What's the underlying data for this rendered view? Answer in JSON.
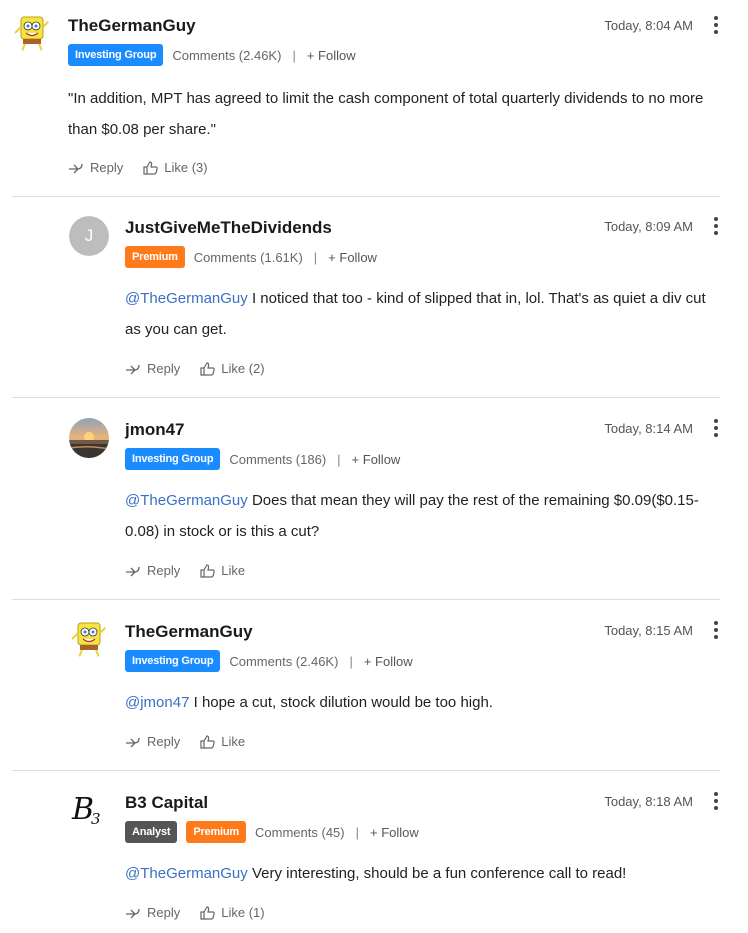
{
  "comments": [
    {
      "username": "TheGermanGuy",
      "avatar": "spongebob-avatar",
      "badges": [
        {
          "label": "Investing Group",
          "color": "#1a8cff"
        }
      ],
      "comments_label": "Comments (2.46K)",
      "follow": "+ Follow",
      "separator": "|",
      "time": "Today, 8:04 AM",
      "text": "\"In addition, MPT has agreed to limit the cash component of total quarterly dividends to no more than $0.08 per share.\"",
      "mention": "",
      "reply": "Reply",
      "like": "Like (3)"
    },
    {
      "username": "JustGiveMeTheDividends",
      "avatar_initial": "J",
      "badges": [
        {
          "label": "Premium",
          "color": "#ff7a1a"
        }
      ],
      "comments_label": "Comments (1.61K)",
      "follow": "+ Follow",
      "separator": "|",
      "time": "Today, 8:09 AM",
      "mention": "@TheGermanGuy",
      "text": " I noticed that too - kind of slipped that in, lol. That's as quiet a div cut as you can get.",
      "reply": "Reply",
      "like": "Like (2)"
    },
    {
      "username": "jmon47",
      "avatar": "sunset-avatar",
      "badges": [
        {
          "label": "Investing Group",
          "color": "#1a8cff"
        }
      ],
      "comments_label": "Comments (186)",
      "follow": "+ Follow",
      "separator": "|",
      "time": "Today, 8:14 AM",
      "mention": "@TheGermanGuy",
      "text": " Does that mean they will pay the rest of the remaining $0.09($0.15-0.08) in stock or is this a cut?",
      "reply": "Reply",
      "like": "Like"
    },
    {
      "username": "TheGermanGuy",
      "avatar": "spongebob-avatar",
      "badges": [
        {
          "label": "Investing Group",
          "color": "#1a8cff"
        }
      ],
      "comments_label": "Comments (2.46K)",
      "follow": "+ Follow",
      "separator": "|",
      "time": "Today, 8:15 AM",
      "mention": "@jmon47",
      "text": " I hope a cut, stock dilution would be too high.",
      "reply": "Reply",
      "like": "Like"
    },
    {
      "username": "B3 Capital",
      "avatar_logo": "B",
      "avatar_logo_sub": "3",
      "badges": [
        {
          "label": "Analyst",
          "color": "#555555"
        },
        {
          "label": "Premium",
          "color": "#ff7a1a"
        }
      ],
      "comments_label": "Comments (45)",
      "follow": "+ Follow",
      "separator": "|",
      "time": "Today, 8:18 AM",
      "mention": "@TheGermanGuy",
      "text": " Very interesting, should be a fun conference call to read!",
      "reply": "Reply",
      "like": "Like (1)"
    }
  ]
}
